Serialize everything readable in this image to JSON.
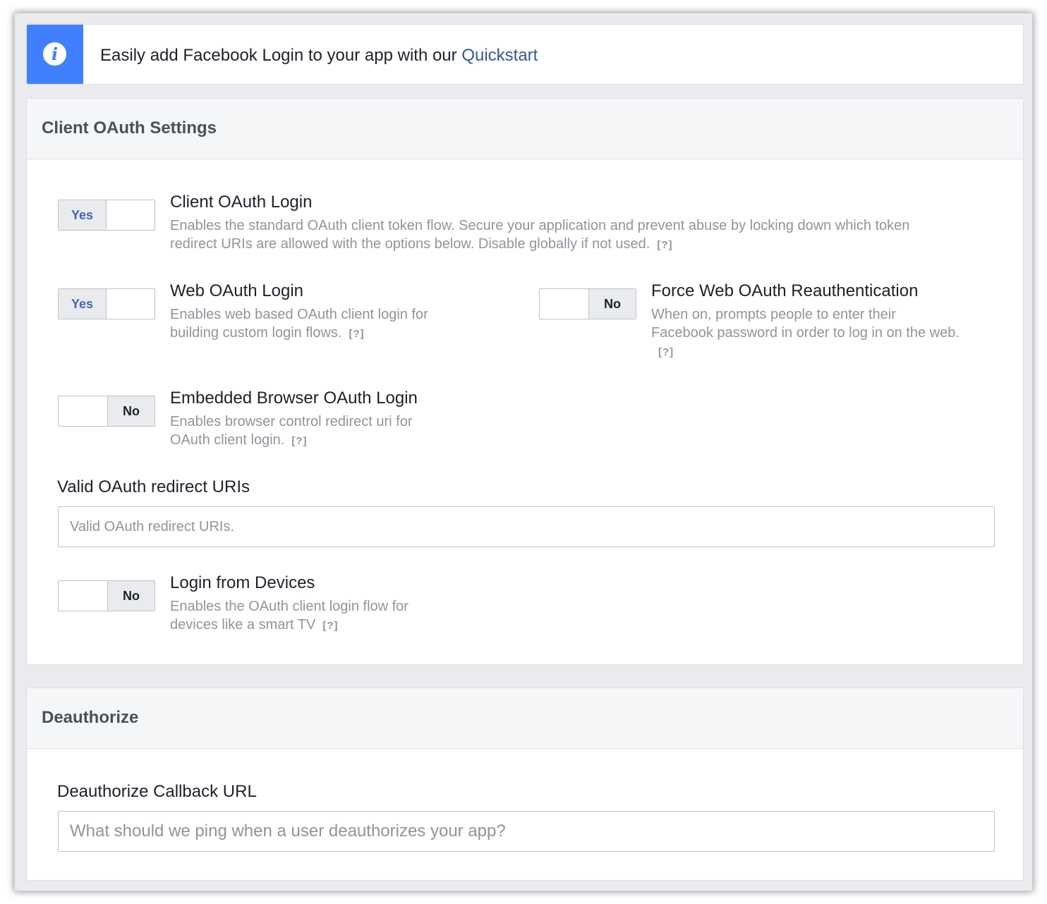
{
  "banner": {
    "text": "Easily add Facebook Login to your app with our ",
    "link": "Quickstart",
    "icon": "info-icon"
  },
  "client_oauth": {
    "title": "Client OAuth Settings",
    "help_label": "[?]",
    "client_login": {
      "toggle": "Yes",
      "title": "Client OAuth Login",
      "desc": "Enables the standard OAuth client token flow. Secure your application and prevent abuse by locking down which token redirect URIs are allowed with the options below. Disable globally if not used."
    },
    "web_login": {
      "toggle": "Yes",
      "title": "Web OAuth Login",
      "desc": "Enables web based OAuth client login for building custom login flows."
    },
    "force_reauth": {
      "toggle": "No",
      "title": "Force Web OAuth Reauthentication",
      "desc": "When on, prompts people to enter their Facebook password in order to log in on the web."
    },
    "embedded_login": {
      "toggle": "No",
      "title": "Embedded Browser OAuth Login",
      "desc": "Enables browser control redirect uri for OAuth client login."
    },
    "redirect_uris": {
      "label": "Valid OAuth redirect URIs",
      "placeholder": "Valid OAuth redirect URIs."
    },
    "devices_login": {
      "toggle": "No",
      "title": "Login from Devices",
      "desc": "Enables the OAuth client login flow for devices like a smart TV"
    }
  },
  "deauthorize": {
    "title": "Deauthorize",
    "callback": {
      "label": "Deauthorize Callback URL",
      "placeholder": "What should we ping when a user deauthorizes your app?"
    }
  }
}
